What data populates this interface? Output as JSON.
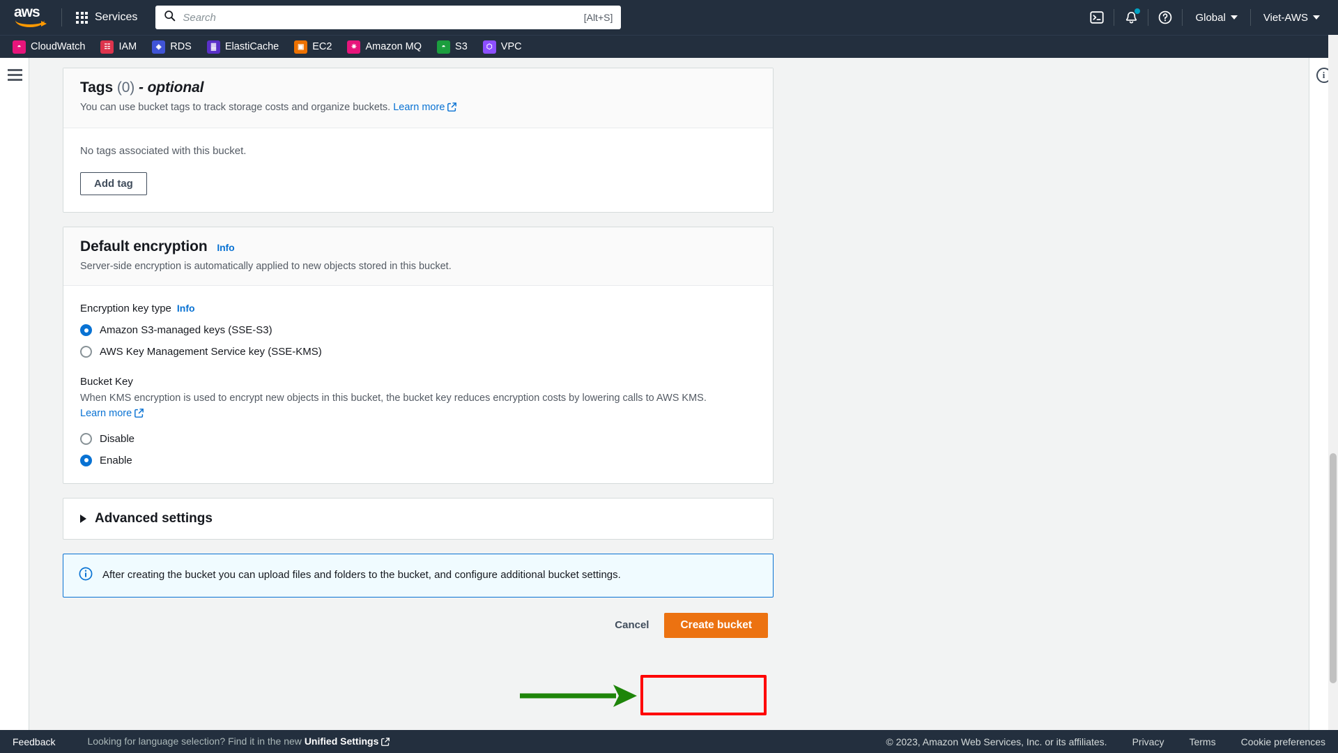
{
  "topnav": {
    "logo_text": "aws",
    "services_label": "Services",
    "services_icon": "grid-apps-icon",
    "search": {
      "placeholder": "Search",
      "value": "",
      "shortcut": "[Alt+S]",
      "icon": "search-icon"
    },
    "cloudshell_icon": "cloudshell-terminal-icon",
    "notifications_icon": "bell-icon",
    "help_icon": "question-circle-icon",
    "region_label": "Global",
    "account_label": "Viet-AWS"
  },
  "favorites": [
    {
      "label": "CloudWatch",
      "icon": "cloudwatch-icon",
      "color": "#e7157b",
      "glyph": "◴"
    },
    {
      "label": "IAM",
      "icon": "iam-icon",
      "color": "#dd344c",
      "glyph": "⌸"
    },
    {
      "label": "RDS",
      "icon": "rds-icon",
      "color": "#4054d6",
      "glyph": "◈"
    },
    {
      "label": "ElastiCache",
      "icon": "elasticache-icon",
      "color": "#5a30c8",
      "glyph": "▓"
    },
    {
      "label": "EC2",
      "icon": "ec2-icon",
      "color": "#ed7100",
      "glyph": "▣"
    },
    {
      "label": "Amazon MQ",
      "icon": "amazon-mq-icon",
      "color": "#e7157b",
      "glyph": "✷"
    },
    {
      "label": "S3",
      "icon": "s3-icon",
      "color": "#1b9e3e",
      "glyph": "◓"
    },
    {
      "label": "VPC",
      "icon": "vpc-icon",
      "color": "#8c4fff",
      "glyph": "⬡"
    }
  ],
  "sidebar": {
    "menu_icon": "hamburger-menu-icon"
  },
  "right_panel": {
    "info_icon": "info-circle-icon"
  },
  "tags_card": {
    "title": "Tags",
    "count": "(0)",
    "optional_suffix": "- optional",
    "description": "You can use bucket tags to track storage costs and organize buckets.",
    "learn_more": "Learn more",
    "empty_text": "No tags associated with this bucket.",
    "add_tag_label": "Add tag"
  },
  "encryption_card": {
    "title": "Default encryption",
    "info_label": "Info",
    "description": "Server-side encryption is automatically applied to new objects stored in this bucket.",
    "key_type": {
      "label": "Encryption key type",
      "info_label": "Info",
      "options": [
        {
          "label": "Amazon S3-managed keys (SSE-S3)",
          "selected": true
        },
        {
          "label": "AWS Key Management Service key (SSE-KMS)",
          "selected": false
        }
      ]
    },
    "bucket_key": {
      "label": "Bucket Key",
      "description": "When KMS encryption is used to encrypt new objects in this bucket, the bucket key reduces encryption costs by lowering calls to AWS KMS.",
      "learn_more": "Learn more",
      "options": [
        {
          "label": "Disable",
          "selected": false
        },
        {
          "label": "Enable",
          "selected": true
        }
      ]
    }
  },
  "advanced_settings": {
    "label": "Advanced settings",
    "expanded": false,
    "toggle_icon": "chevron-right-triangle-icon"
  },
  "info_alert": {
    "icon": "info-circle-icon",
    "text": "After creating the bucket you can upload files and folders to the bucket, and configure additional bucket settings."
  },
  "actions": {
    "cancel_label": "Cancel",
    "create_label": "Create bucket"
  },
  "annotations": {
    "highlight_color": "#fe0000",
    "arrow_color": "#1e8509",
    "arrow_target": "create-bucket-button"
  },
  "footer": {
    "feedback": "Feedback",
    "language_prefix": "Looking for language selection? Find it in the new",
    "language_link": "Unified Settings",
    "copyright": "© 2023, Amazon Web Services, Inc. or its affiliates.",
    "links": [
      "Privacy",
      "Terms",
      "Cookie preferences"
    ]
  }
}
